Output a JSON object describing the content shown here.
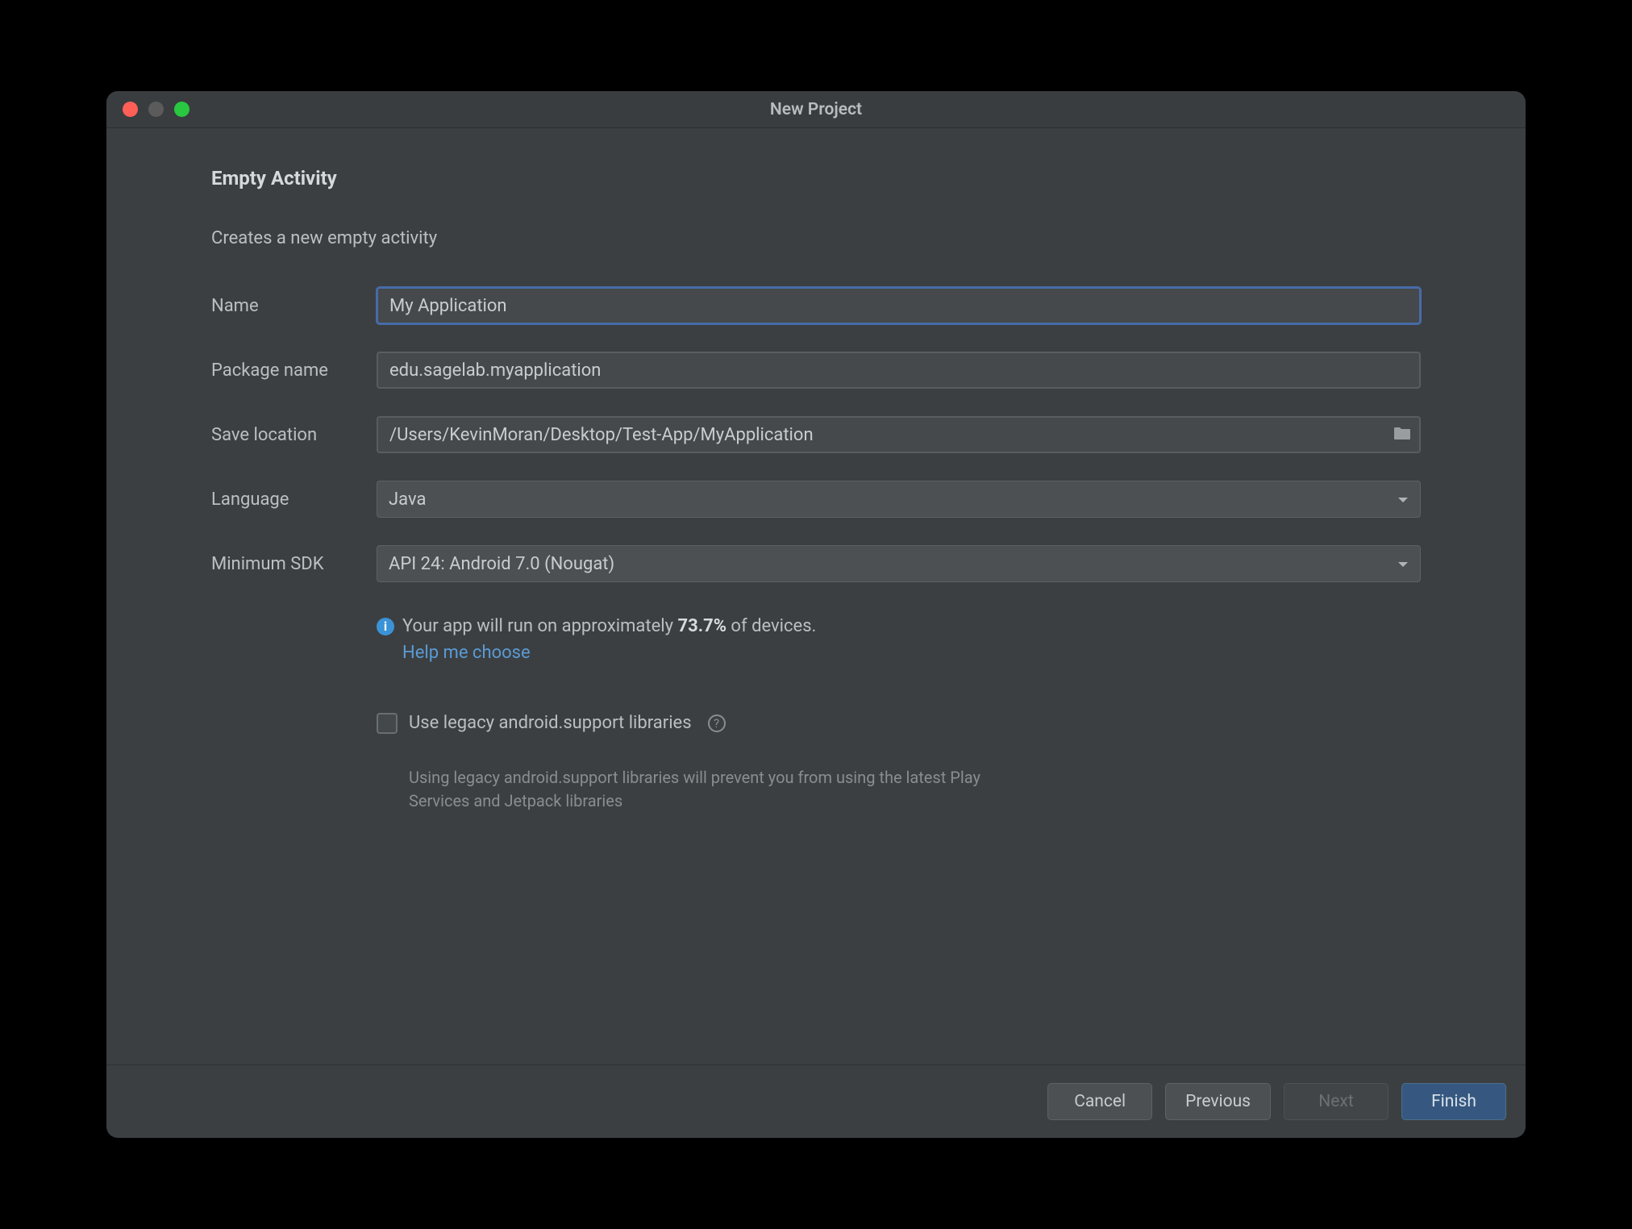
{
  "window": {
    "title": "New Project"
  },
  "page": {
    "heading": "Empty Activity",
    "subheading": "Creates a new empty activity"
  },
  "form": {
    "name_label": "Name",
    "name_value": "My Application",
    "package_label": "Package name",
    "package_value": "edu.sagelab.myapplication",
    "location_label": "Save location",
    "location_value": "/Users/KevinMoran/Desktop/Test-App/MyApplication",
    "language_label": "Language",
    "language_value": "Java",
    "sdk_label": "Minimum SDK",
    "sdk_value": "API 24: Android 7.0 (Nougat)"
  },
  "info": {
    "prefix": "Your app will run on approximately ",
    "percent": "73.7%",
    "suffix": " of devices.",
    "help_link": "Help me choose"
  },
  "legacy": {
    "label": "Use legacy android.support libraries",
    "hint": "Using legacy android.support libraries will prevent you from using the latest Play Services and Jetpack libraries"
  },
  "footer": {
    "cancel": "Cancel",
    "previous": "Previous",
    "next": "Next",
    "finish": "Finish"
  }
}
